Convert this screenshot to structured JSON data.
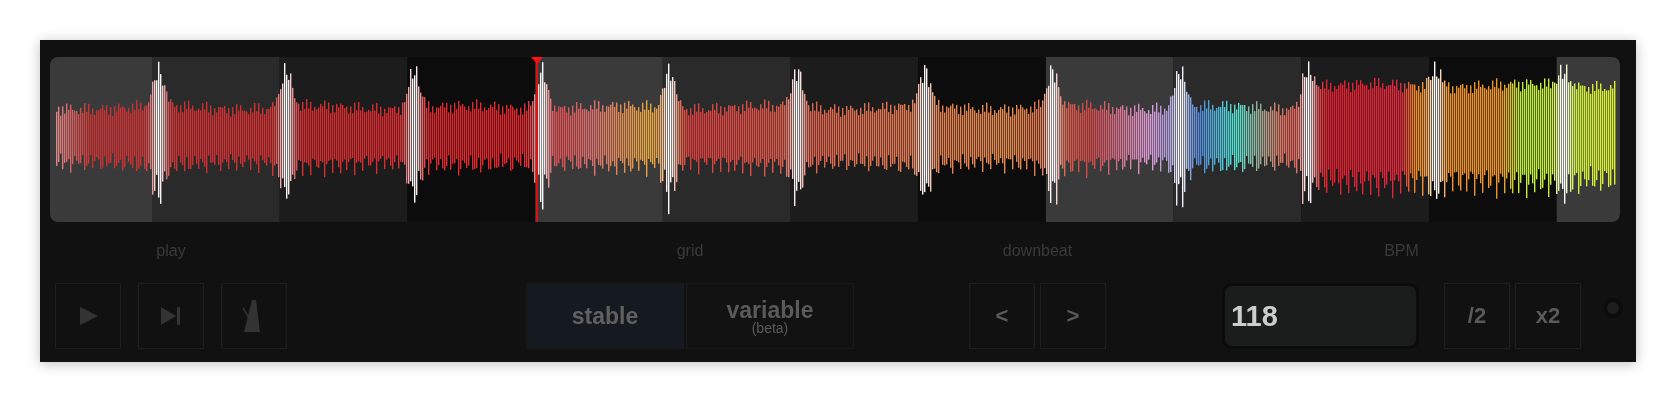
{
  "groups": [
    {
      "label": "play",
      "kind": "icons",
      "buttons": [
        {
          "kind": "play"
        },
        {
          "kind": "skip"
        },
        {
          "kind": "metronome"
        }
      ]
    },
    {
      "label": "grid",
      "kind": "segmented",
      "options": [
        {
          "label": "stable",
          "selected": true
        },
        {
          "label": "variable",
          "sublabel": "(beta)",
          "selected": false
        }
      ]
    },
    {
      "label": "downbeat",
      "kind": "text",
      "buttons": [
        {
          "label": "<"
        },
        {
          "label": ">"
        }
      ]
    },
    {
      "label": "BPM",
      "kind": "bpm",
      "value": "118",
      "buttons": [
        {
          "label": "/2"
        },
        {
          "label": "x2"
        }
      ]
    }
  ]
}
